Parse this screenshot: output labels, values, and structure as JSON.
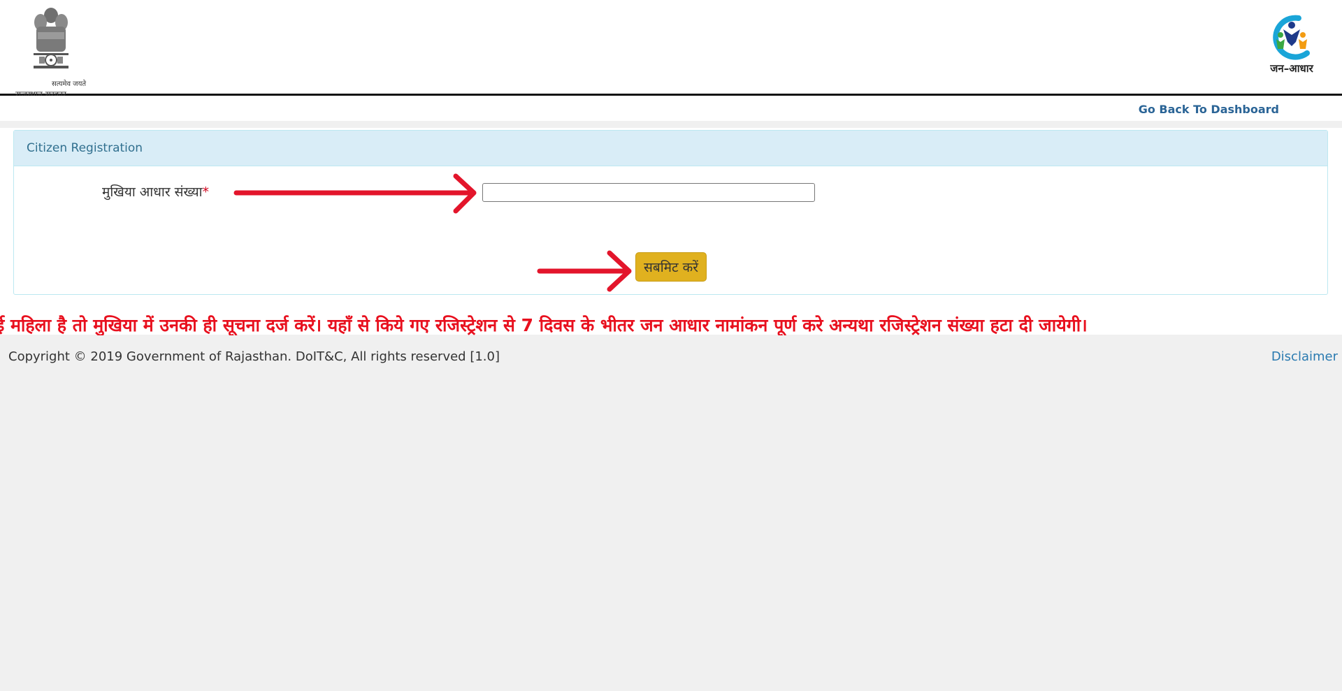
{
  "header": {
    "emblem_motto": "सत्यमेव जयते",
    "emblem_label": "राजस्थान सरकार",
    "logo_text": "जन–आधार",
    "emblem_icon": "ashoka-emblem-icon",
    "logo_icon": "jan-aadhaar-logo-icon"
  },
  "nav": {
    "dashboard_link": "Go Back To Dashboard"
  },
  "panel": {
    "title": "Citizen Registration",
    "field_label": "मुखिया आधार संख्या",
    "required_mark": "*",
    "aadhaar_value": "",
    "submit_label": "सबमिट करें"
  },
  "notice": {
    "text": "ई महिला है तो मुखिया में उनकी ही सूचना दर्ज करें। यहाँ से किये गए रजिस्ट्रेशन से 7 दिवस के भीतर जन आधार नामांकन पूर्ण करे अन्यथा रजिस्ट्रेशन संख्या हटा दी जायेगी।"
  },
  "footer": {
    "copyright": "Copyright © 2019 Government of Rajasthan. DoIT&C, All rights reserved [1.0]",
    "disclaimer": "Disclaimer"
  },
  "colors": {
    "accent_blue": "#2a6496",
    "panel_heading_bg": "#d9edf7",
    "submit_button": "#e0b11f",
    "notice_red": "#e8101e",
    "arrow_red": "#e3152b"
  }
}
